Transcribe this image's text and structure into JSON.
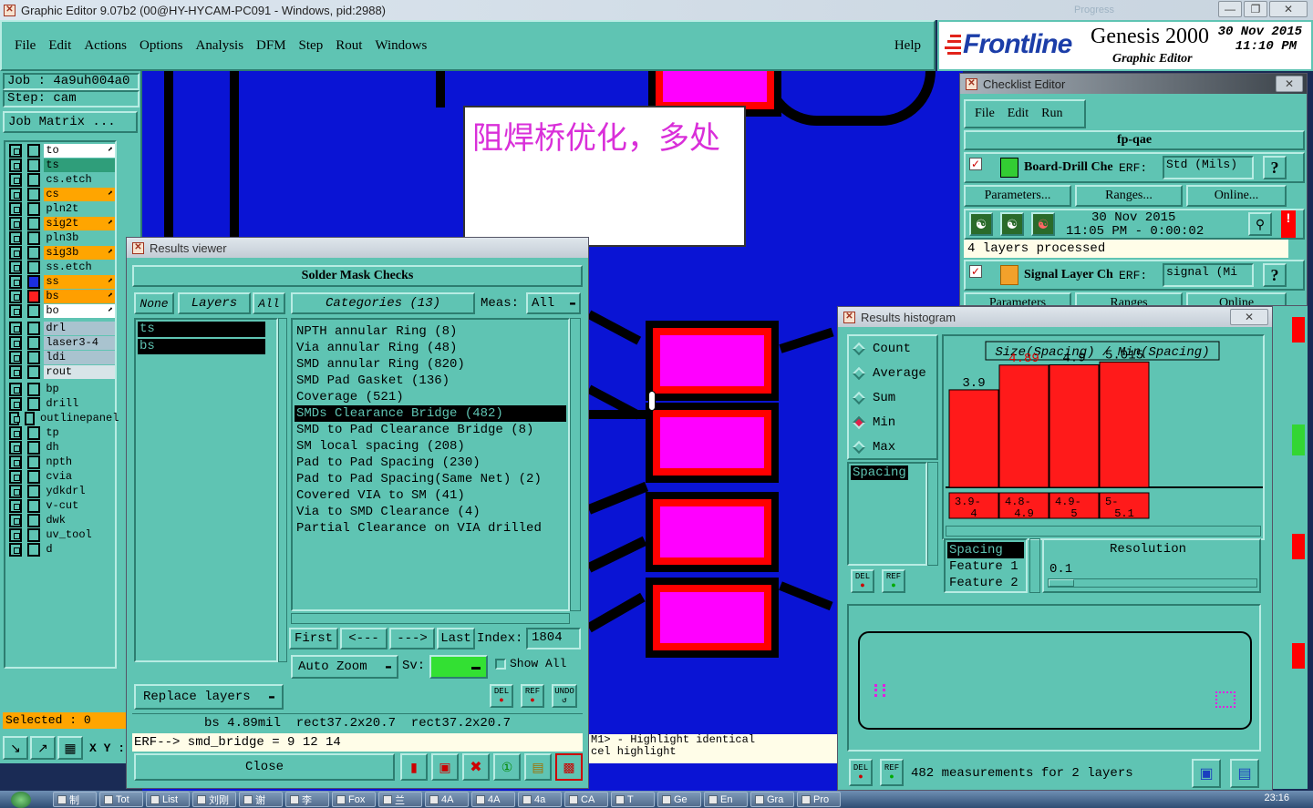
{
  "window": {
    "title": "Graphic Editor 9.07b2 (00@HY-HYCAM-PC091 - Windows, pid:2988)",
    "ghost_title": "Progress"
  },
  "menubar": {
    "items": [
      "File",
      "Edit",
      "Actions",
      "Options",
      "Analysis",
      "DFM",
      "Step",
      "Rout",
      "Windows"
    ],
    "help": "Help"
  },
  "brand": {
    "logo": "Frontline",
    "product": "Genesis 2000",
    "subtitle": "Graphic Editor",
    "date": "30 Nov 2015",
    "time": "11:10 PM"
  },
  "job": {
    "job_label": "Job : 4a9uh004a0",
    "step_label": "Step: cam",
    "matrix_button": "Job Matrix ..."
  },
  "layers": [
    {
      "name": "to",
      "color": "#ffffff",
      "mark": "⬈"
    },
    {
      "name": "ts",
      "color": "#2f9e7a",
      "mark": ""
    },
    {
      "name": "cs.etch",
      "color": "#5fc4b3",
      "mark": ""
    },
    {
      "name": "cs",
      "color": "#ffa500",
      "mark": "⬈"
    },
    {
      "name": "pln2t",
      "color": "#5fc4b3",
      "mark": ""
    },
    {
      "name": "sig2t",
      "color": "#ffa500",
      "mark": "⬈"
    },
    {
      "name": "pln3b",
      "color": "#5fc4b3",
      "mark": ""
    },
    {
      "name": "sig3b",
      "color": "#ffa500",
      "mark": "⬈"
    },
    {
      "name": "ss.etch",
      "color": "#5fc4b3",
      "mark": ""
    },
    {
      "name": "ss",
      "color": "#ffa500",
      "mark": "⬈"
    },
    {
      "name": "bs",
      "color": "#ff9f00",
      "mark": "⬈"
    },
    {
      "name": "bo",
      "color": "#ffffff",
      "mark": "⬈"
    },
    {
      "name": "drl",
      "color": "#a9c3cf",
      "mark": ""
    },
    {
      "name": "laser3-4",
      "color": "#a9c3cf",
      "mark": ""
    },
    {
      "name": "ldi",
      "color": "#a9c3cf",
      "mark": ""
    },
    {
      "name": "rout",
      "color": "#d8e4e8",
      "mark": ""
    },
    {
      "name": "bp",
      "color": "#5fc4b3",
      "mark": ""
    },
    {
      "name": "drill",
      "color": "#5fc4b3",
      "mark": ""
    },
    {
      "name": "outlinepanel",
      "color": "#5fc4b3",
      "mark": ""
    },
    {
      "name": "tp",
      "color": "#5fc4b3",
      "mark": ""
    },
    {
      "name": "dh",
      "color": "#5fc4b3",
      "mark": ""
    },
    {
      "name": "npth",
      "color": "#5fc4b3",
      "mark": ""
    },
    {
      "name": "cvia",
      "color": "#5fc4b3",
      "mark": ""
    },
    {
      "name": "ydkdrl",
      "color": "#5fc4b3",
      "mark": ""
    },
    {
      "name": "v-cut",
      "color": "#5fc4b3",
      "mark": ""
    },
    {
      "name": "dwk",
      "color": "#5fc4b3",
      "mark": ""
    },
    {
      "name": "uv_tool",
      "color": "#5fc4b3",
      "mark": ""
    },
    {
      "name": "d",
      "color": "#5fc4b3",
      "mark": ""
    }
  ],
  "status": {
    "selected": "Selected : 0",
    "xy": "X Y :"
  },
  "annotation": {
    "text": "阻焊桥优化，多处"
  },
  "results_viewer": {
    "title": "Results viewer",
    "header": "Solder Mask Checks",
    "none_btn": "None",
    "layers_btn": "Layers",
    "all_btn": "All",
    "categories_btn": "Categories (13)",
    "meas_label": "Meas:",
    "meas_value": "All",
    "layer_items": [
      "ts",
      "bs"
    ],
    "categories": [
      "NPTH annular Ring (8)",
      "Via annular Ring (48)",
      "SMD annular Ring (820)",
      "SMD Pad Gasket (136)",
      "Coverage (521)",
      "SMDs Clearance Bridge (482)",
      "SMD to Pad Clearance Bridge (8)",
      "SM local spacing (208)",
      "Pad to Pad Spacing (230)",
      "Pad to Pad Spacing(Same Net) (2)",
      "Covered VIA to SM (41)",
      "Via to SMD Clearance (4)",
      "Partial Clearance on VIA drilled"
    ],
    "selected_index": 5,
    "nav": {
      "first": "First",
      "prev": "<---",
      "next": "--->",
      "last": "Last",
      "index_label": "Index:",
      "index_value": "1804"
    },
    "auto_zoom": "Auto Zoom",
    "sv_label": "Sv:",
    "show_all": "Show All",
    "replace_layers": "Replace layers",
    "del": "DEL",
    "ref": "REF",
    "undo": "UNDO",
    "info_line": "bs 4.89mil  rect37.2x20.7  rect37.2x20.7",
    "erf_line": "ERF--> smd_bridge = 9 12 14",
    "close": "Close"
  },
  "hint": {
    "line1": "M1> - Highlight identical",
    "line2": "cel highlight"
  },
  "checklist": {
    "title": "Checklist Editor",
    "menu": [
      "File",
      "Edit",
      "Run"
    ],
    "name": "fp-qae",
    "item1": {
      "label": "Board-Drill Che",
      "erf": "ERF:",
      "value": "Std (Mils)",
      "q": "?"
    },
    "buttons": [
      "Parameters...",
      "Ranges...",
      "Online..."
    ],
    "run_date": "30 Nov 2015",
    "run_time": "11:05 PM - 0:00:02",
    "processed": "4 layers processed",
    "item2": {
      "label": "Signal Layer Ch",
      "erf": "ERF:",
      "value": "signal (Mi",
      "q": "?"
    },
    "partial": [
      "Parameters",
      "Ranges",
      "Online"
    ]
  },
  "histogram": {
    "title": "Results histogram",
    "modes": [
      "Count",
      "Average",
      "Sum",
      "Min",
      "Max"
    ],
    "selected_mode": "Min",
    "list_item": "Spacing",
    "chart_title": "Size(Spacing) / Min(Spacing)",
    "feature_list": [
      "Spacing",
      "Feature 1",
      "Feature 2"
    ],
    "resolution_label": "Resolution",
    "resolution_value": "0.1",
    "footer": "482 measurements for 2 layers",
    "del": "DEL",
    "ref": "REF"
  },
  "chart_data": {
    "type": "bar",
    "title": "Size(Spacing) / Min(Spacing)",
    "categories": [
      "3.9-4",
      "4.8-4.9",
      "4.9-5",
      "5-5.1"
    ],
    "values": [
      3.9,
      4.89,
      4.9,
      5.015
    ],
    "value_labels": [
      "3.9",
      "4.89",
      "4.9",
      "5.015"
    ],
    "category_labels": [
      [
        "3.9-",
        "4"
      ],
      [
        "4.8-",
        "4.9"
      ],
      [
        "4.9-",
        "5"
      ],
      [
        "5-",
        "5.1"
      ]
    ],
    "highlight_index": 1,
    "ylim": [
      0,
      5.1
    ],
    "bar_color": "#ff1a1a",
    "highlight_label_color": "#e00000"
  },
  "taskbar": {
    "items": [
      "制",
      "Tot",
      "List",
      "刘刚",
      "谢",
      "李",
      "Fox",
      "兰",
      "4A",
      "4A",
      "4a",
      "CA",
      "T",
      "Ge",
      "En",
      "Gra",
      "Pro"
    ],
    "clock": "23:16"
  },
  "colors": {
    "canvas": "#0a14d4",
    "panel": "#5fc4b3",
    "pad": "#ff00ff",
    "pad_ring": "#ff0000"
  }
}
